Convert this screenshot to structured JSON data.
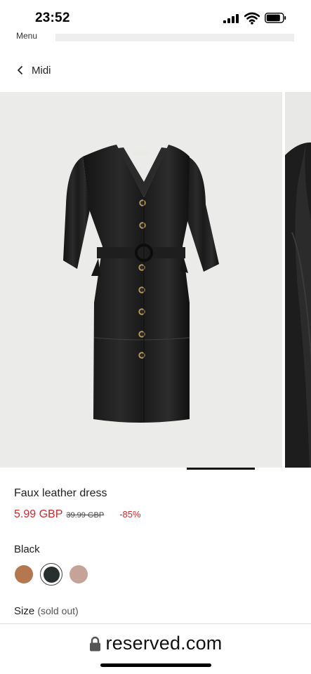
{
  "status_bar": {
    "time": "23:52",
    "signal_bars": 4,
    "battery_level": 0.8
  },
  "menu": {
    "label": "Menu"
  },
  "breadcrumb": {
    "back_icon": "chevron-left-icon",
    "label": "Midi"
  },
  "gallery": {
    "current_index": 1,
    "image_subject": "black faux leather button-front midi dress with belt"
  },
  "product": {
    "name": "Faux leather dress",
    "price_now": "5.99 GBP",
    "price_old": "39.99 GBP",
    "discount": "-85%"
  },
  "color": {
    "selected_label": "Black",
    "swatches": [
      {
        "name": "tan",
        "hex": "#b5774e"
      },
      {
        "name": "black",
        "hex": "#27302e",
        "selected": true
      },
      {
        "name": "pink-beige",
        "hex": "#c6a398"
      }
    ]
  },
  "size": {
    "label": "Size",
    "note": "(sold out)"
  },
  "browser": {
    "url": "reserved.com"
  },
  "colors": {
    "sale_red": "#d3272b",
    "text": "#1f1f1f"
  }
}
